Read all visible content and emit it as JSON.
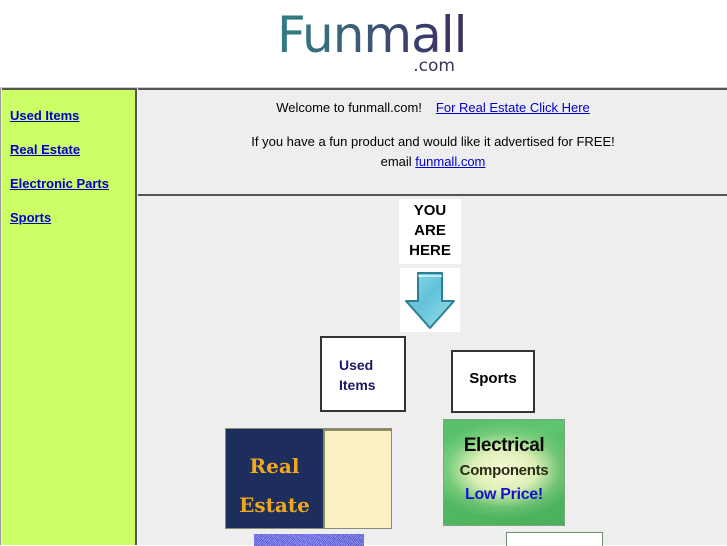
{
  "site": {
    "logo_text": "Funmall",
    "logo_suffix": ".com"
  },
  "sidebar": {
    "items": [
      {
        "label": "Used Items"
      },
      {
        "label": "Real Estate"
      },
      {
        "label": "Electronic Parts"
      },
      {
        "label": "Sports"
      }
    ],
    "background_color": "#ccff66",
    "link_color": "#0000cc"
  },
  "welcome": {
    "greeting": "Welcome to funmall.com!",
    "real_estate_link": "For Real Estate Click Here",
    "promo_line": "If you have a fun product and would like it advertised for FREE!",
    "email_prefix": "email ",
    "email_link": "funmall.com"
  },
  "tiles": {
    "you_are_here": {
      "line1": "YOU",
      "line2": "ARE",
      "line3": "HERE"
    },
    "arrow": {
      "icon": "down-arrow-icon",
      "fill_color": "#6ec5dd",
      "stroke_color": "#2a7f93"
    },
    "used_items": {
      "line1": "Used",
      "line2": "Items",
      "text_color": "#1a1a66"
    },
    "sports": {
      "label": "Sports",
      "text_color": "#000000"
    },
    "real_estate": {
      "line1": "Real",
      "line2": "Estate",
      "text_color": "#f0a81e",
      "panel_color": "#1d2d5c",
      "accent_color": "#f9f0c3"
    },
    "electrical": {
      "line1": "Electrical",
      "line2": "Components",
      "line3": "Low Price!",
      "background_color": "#4fc464",
      "line3_color": "#1515c8"
    }
  }
}
